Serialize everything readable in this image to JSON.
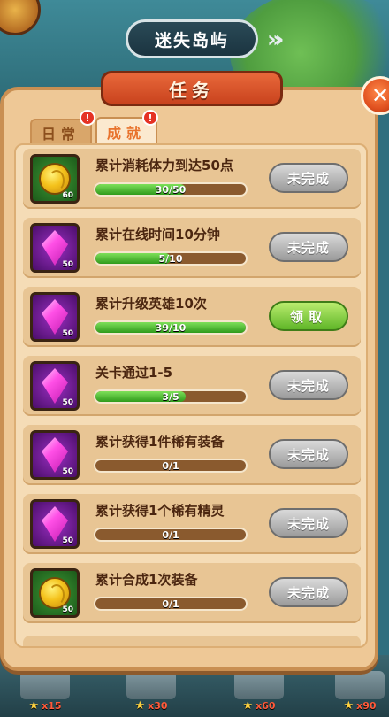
{
  "header": {
    "location": "迷失岛屿"
  },
  "panel": {
    "title": "任务",
    "close_symbol": "✕",
    "tabs": [
      {
        "label": "日常",
        "active": false,
        "alert": "!"
      },
      {
        "label": "成就",
        "active": true,
        "alert": "!"
      }
    ]
  },
  "tasks": [
    {
      "title": "累计消耗体力到达50点",
      "reward_icon": "gold-coin-icon",
      "reward": "60",
      "progress_text": "30/50",
      "progress": 0.6,
      "button": "未完成",
      "state": "pending"
    },
    {
      "title": "累计在线时间10分钟",
      "reward_icon": "purple-gem-icon",
      "reward": "50",
      "progress_text": "5/10",
      "progress": 0.5,
      "button": "未完成",
      "state": "pending"
    },
    {
      "title": "累计升级英雄10次",
      "reward_icon": "purple-gem-icon",
      "reward": "50",
      "progress_text": "39/10",
      "progress": 1.0,
      "button": "领取",
      "state": "claim"
    },
    {
      "title": "关卡通过1-5",
      "reward_icon": "purple-gem-icon",
      "reward": "50",
      "progress_text": "3/5",
      "progress": 0.6,
      "button": "未完成",
      "state": "pending"
    },
    {
      "title": "累计获得1件稀有装备",
      "reward_icon": "purple-gem-icon",
      "reward": "50",
      "progress_text": "0/1",
      "progress": 0,
      "button": "未完成",
      "state": "pending"
    },
    {
      "title": "累计获得1个稀有精灵",
      "reward_icon": "purple-gem-icon",
      "reward": "50",
      "progress_text": "0/1",
      "progress": 0,
      "button": "未完成",
      "state": "pending"
    },
    {
      "title": "累计合成1次装备",
      "reward_icon": "gold-coin-icon",
      "reward": "50",
      "progress_text": "0/1",
      "progress": 0,
      "button": "未完成",
      "state": "pending"
    }
  ],
  "bottom_bar": [
    {
      "count": "x15"
    },
    {
      "count": "x30"
    },
    {
      "count": "x60"
    },
    {
      "count": "x90"
    }
  ]
}
